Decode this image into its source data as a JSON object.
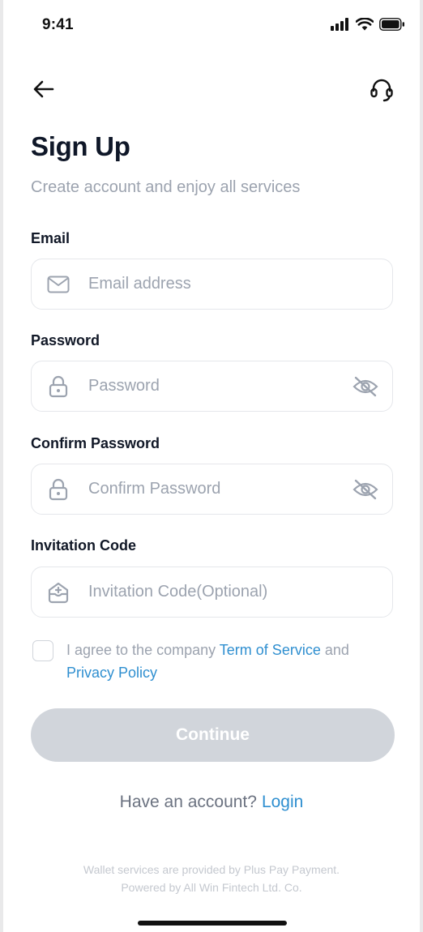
{
  "status_bar": {
    "time": "9:41"
  },
  "header": {
    "back_icon": "arrow-left-icon",
    "support_icon": "headset-icon"
  },
  "page": {
    "title": "Sign Up",
    "subtitle": "Create account and enjoy all services"
  },
  "form": {
    "email": {
      "label": "Email",
      "placeholder": "Email address",
      "value": "",
      "icon": "mail-icon"
    },
    "password": {
      "label": "Password",
      "placeholder": "Password",
      "value": "",
      "icon": "lock-icon",
      "toggle_icon": "eye-off-icon"
    },
    "confirm_password": {
      "label": "Confirm Password",
      "placeholder": "Confirm Password",
      "value": "",
      "icon": "lock-icon",
      "toggle_icon": "eye-off-icon"
    },
    "invitation_code": {
      "label": "Invitation Code",
      "placeholder": "Invitation Code(Optional)",
      "value": "",
      "icon": "gift-box-icon"
    }
  },
  "agreement": {
    "checked": false,
    "text_before": "I agree to the company ",
    "terms_link": "Term of Service",
    "text_middle": " and ",
    "privacy_link": "Privacy Policy"
  },
  "actions": {
    "continue_label": "Continue"
  },
  "login": {
    "prompt": "Have an account?",
    "link": "Login"
  },
  "footer": {
    "line1": "Wallet services are provided by Plus Pay Payment.",
    "line2": "Powered by All Win Fintech Ltd. Co."
  },
  "colors": {
    "accent": "#2f8fd0",
    "button_disabled": "#d1d5db",
    "placeholder": "#9ca3af",
    "border": "#e5e7eb"
  }
}
